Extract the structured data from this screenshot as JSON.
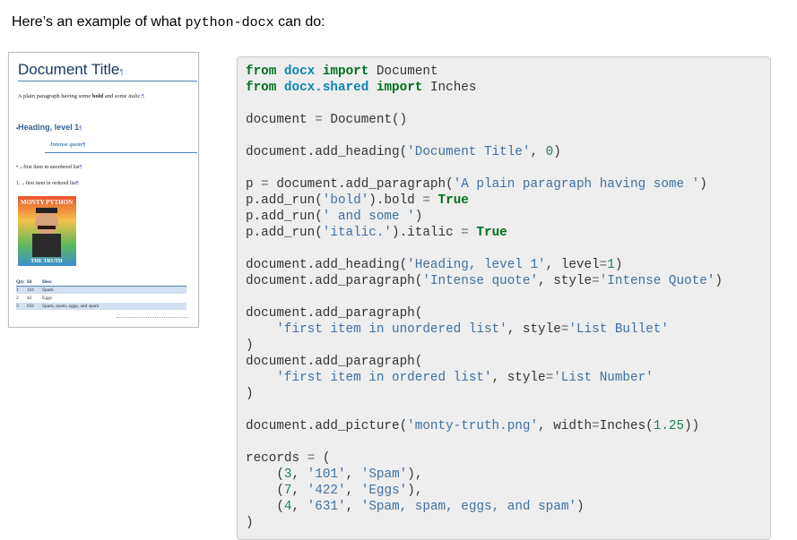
{
  "intro": {
    "prefix": "Here’s an example of what ",
    "code": "python-docx",
    "suffix": " can do:"
  },
  "preview": {
    "title": "Document Title",
    "paragraph_plain": "A plain paragraph having some ",
    "paragraph_bold": "bold",
    "paragraph_mid": " and some ",
    "paragraph_italic": "italic.",
    "heading": "Heading, level 1",
    "quote": "Intense quote",
    "bullet_item": "first item in unordered list",
    "number_marker": "1.",
    "numbered_item": "first item in ordered list",
    "poster_top": "MONTY PYTHON",
    "poster_bottom": "THE TRUTH",
    "table": {
      "headers": [
        "Qty",
        "Id",
        "Desc"
      ],
      "rows": [
        [
          "1",
          "101",
          "Spam"
        ],
        [
          "2",
          "42",
          "Eggs"
        ],
        [
          "3",
          "631",
          "Spam, spam, eggs, and spam"
        ]
      ]
    }
  },
  "code": {
    "kw_from": "from",
    "kw_import": "import",
    "kw_true": "True",
    "mod_docx": "docx",
    "mod_docx_shared": "docx.shared",
    "name_document_cls": "Document",
    "name_inches": "Inches",
    "s_title": "'Document Title'",
    "n_0": "0",
    "s_plain": "'A plain paragraph having some '",
    "s_bold": "'bold'",
    "s_and_some": "' and some '",
    "s_italic": "'italic.'",
    "s_heading": "'Heading, level 1'",
    "n_1": "1",
    "s_intense": "'Intense quote'",
    "s_intense_style": "'Intense Quote'",
    "s_first_unordered": "'first item in unordered list'",
    "s_list_bullet": "'List Bullet'",
    "s_first_ordered": "'first item in ordered list'",
    "s_list_number": "'List Number'",
    "s_png": "'monty-truth.png'",
    "n_125": "1.25",
    "n_3": "3",
    "s_101": "'101'",
    "s_spam": "'Spam'",
    "n_7": "7",
    "s_422": "'422'",
    "s_eggs": "'Eggs'",
    "n_4": "4",
    "s_631": "'631'",
    "s_spam_long": "'Spam, spam, eggs, and spam'"
  }
}
